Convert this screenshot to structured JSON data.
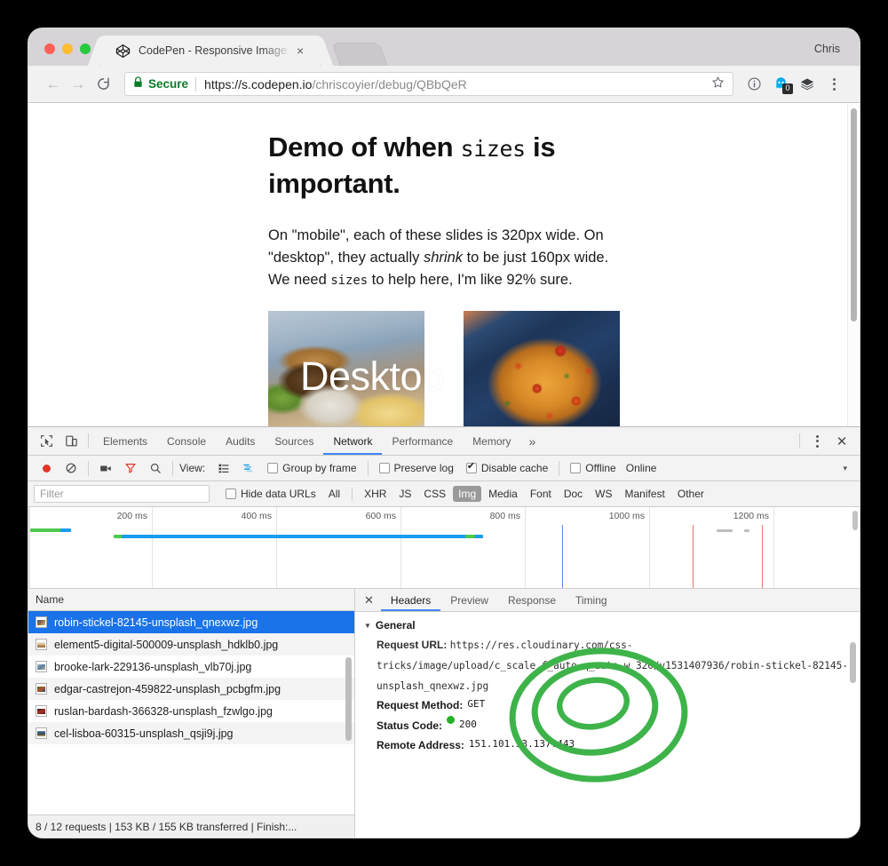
{
  "browser": {
    "tab": {
      "title": "CodePen - Responsive Images",
      "close_label": "×",
      "favicon": "codepen-icon"
    },
    "profile_name": "Chris",
    "nav": {
      "back": "←",
      "forward": "→",
      "reload": "⟳"
    },
    "omnibox": {
      "secure_label": "Secure",
      "url_host": "https://s.codepen.io",
      "url_path": "/chriscoyier/debug/QBbQeR",
      "star": "☆",
      "info": "ⓘ",
      "ext_badge": "0"
    }
  },
  "page": {
    "heading_part1": "Demo of when ",
    "heading_code": "sizes",
    "heading_part2": " is important.",
    "paragraph_1": "On \"mobile\", each of these slides is 320px wide. On \"desktop\", they actually ",
    "paragraph_em": "shrink",
    "paragraph_2": " to be just 160px wide. We need ",
    "paragraph_code": "sizes",
    "paragraph_3": " to help here, I'm like 92% sure.",
    "overlay_text": "Desktop",
    "slide_1_alt": "burger-and-fries-photo",
    "slide_2_alt": "paella-skillet-photo"
  },
  "devtools": {
    "tabs": [
      {
        "label": "Elements",
        "active": false
      },
      {
        "label": "Console",
        "active": false
      },
      {
        "label": "Audits",
        "active": false
      },
      {
        "label": "Sources",
        "active": false
      },
      {
        "label": "Network",
        "active": true
      },
      {
        "label": "Performance",
        "active": false
      },
      {
        "label": "Memory",
        "active": false
      }
    ],
    "more_tabs": "»",
    "close": "✕",
    "controls": {
      "view_label": "View:",
      "group_by_frame": {
        "label": "Group by frame",
        "checked": false
      },
      "preserve_log": {
        "label": "Preserve log",
        "checked": false
      },
      "disable_cache": {
        "label": "Disable cache",
        "checked": true
      },
      "offline": {
        "label": "Offline",
        "checked": false
      },
      "online_label": "Online",
      "throttle_caret": "▾"
    },
    "filter": {
      "placeholder": "Filter",
      "value": "",
      "hide_data_urls": {
        "label": "Hide data URLs",
        "checked": false
      },
      "types": [
        {
          "label": "All",
          "selected": false
        },
        {
          "label": "XHR",
          "selected": false
        },
        {
          "label": "JS",
          "selected": false
        },
        {
          "label": "CSS",
          "selected": false
        },
        {
          "label": "Img",
          "selected": true
        },
        {
          "label": "Media",
          "selected": false
        },
        {
          "label": "Font",
          "selected": false
        },
        {
          "label": "Doc",
          "selected": false
        },
        {
          "label": "WS",
          "selected": false
        },
        {
          "label": "Manifest",
          "selected": false
        },
        {
          "label": "Other",
          "selected": false
        }
      ]
    },
    "overview": {
      "ticks": [
        "200 ms",
        "400 ms",
        "600 ms",
        "800 ms",
        "1000 ms",
        "1200 ms"
      ]
    },
    "requests": {
      "column_header": "Name",
      "rows": [
        {
          "name": "robin-stickel-82145-unsplash_qnexwz.jpg",
          "selected": true
        },
        {
          "name": "element5-digital-500009-unsplash_hdklb0.jpg",
          "selected": false
        },
        {
          "name": "brooke-lark-229136-unsplash_vlb70j.jpg",
          "selected": false
        },
        {
          "name": "edgar-castrejon-459822-unsplash_pcbgfm.jpg",
          "selected": false
        },
        {
          "name": "ruslan-bardash-366328-unsplash_fzwlgo.jpg",
          "selected": false
        },
        {
          "name": "cel-lisboa-60315-unsplash_qsji9j.jpg",
          "selected": false
        }
      ],
      "status_bar": "8 / 12 requests | 153 KB / 155 KB transferred | Finish:..."
    },
    "detail": {
      "close": "✕",
      "tabs": [
        {
          "label": "Headers",
          "active": true
        },
        {
          "label": "Preview",
          "active": false
        },
        {
          "label": "Response",
          "active": false
        },
        {
          "label": "Timing",
          "active": false
        }
      ],
      "section_general": "General",
      "request_url_key": "Request URL:",
      "request_url_value": "https://res.cloudinary.com/css-tricks/image/upload/c_scale,f_auto,q_auto,w_320/v1531407936/robin-stickel-82145-unsplash_qnexwz.jpg",
      "request_method_key": "Request Method:",
      "request_method_value": "GET",
      "status_code_key": "Status Code:",
      "status_code_value": "200",
      "remote_address_key": "Remote Address:",
      "remote_address_value": "151.101.53.137:443"
    }
  },
  "annotation": {
    "color": "#3eb34a",
    "target": "w_320"
  }
}
